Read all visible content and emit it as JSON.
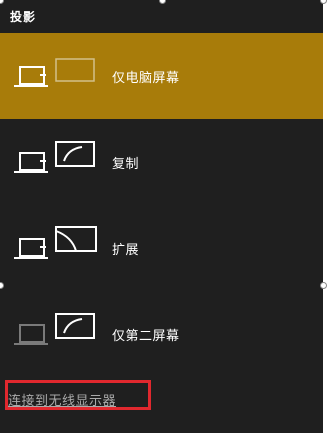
{
  "panel": {
    "title": "投影"
  },
  "options": [
    {
      "label": "仅电脑屏幕",
      "icon": "pc-screen-only-icon",
      "selected": true
    },
    {
      "label": "复制",
      "icon": "duplicate-icon",
      "selected": false
    },
    {
      "label": "扩展",
      "icon": "extend-icon",
      "selected": false
    },
    {
      "label": "仅第二屏幕",
      "icon": "second-screen-only-icon",
      "selected": false
    }
  ],
  "wireless": {
    "label": "连接到无线显示器"
  },
  "colors": {
    "panel_bg": "#1f1f1f",
    "selected_bg": "#a87c0a",
    "highlight": "#e0282e",
    "link": "#aaaaaa"
  }
}
